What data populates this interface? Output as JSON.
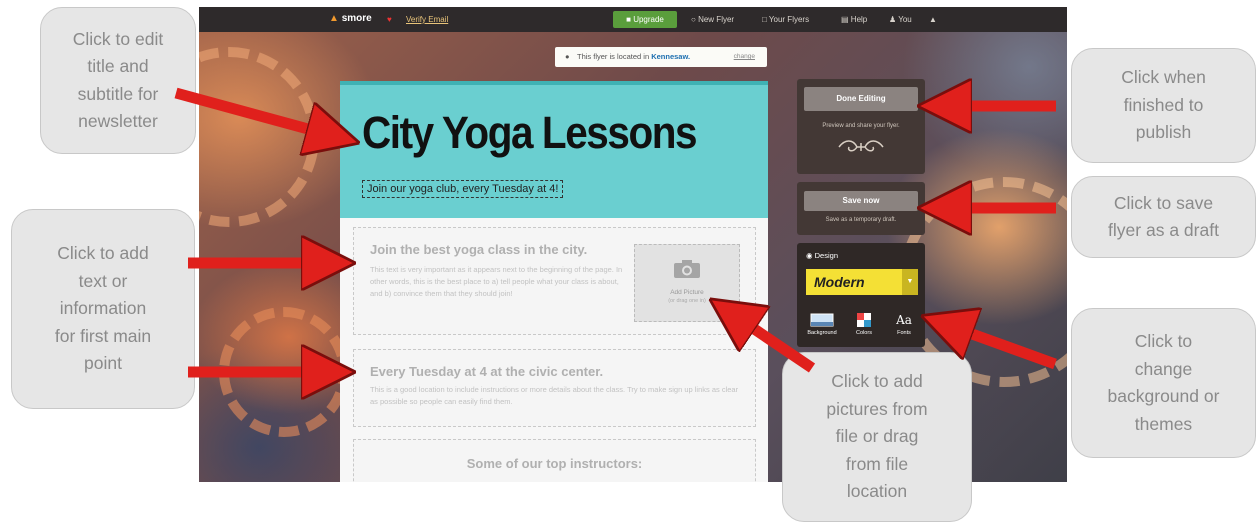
{
  "topbar": {
    "brand": "smore",
    "verify": "Verify Email",
    "upgrade": "Upgrade",
    "new_flyer": "New Flyer",
    "your_flyers": "Your Flyers",
    "help": "Help",
    "you": "You"
  },
  "location": {
    "prefix": "This flyer is located in ",
    "city": "Kennesaw.",
    "change": "change"
  },
  "flyer": {
    "title": "City Yoga Lessons",
    "subtitle": "Join our yoga club, every Tuesday at 4!",
    "block1": {
      "heading": "Join the best yoga class in the city.",
      "body": "This text is very important as it appears next to the beginning of the page. In other words, this is the best place to a) tell people what your class is about, and b) convince them that they should join!"
    },
    "picture": {
      "label": "Add Picture",
      "sub": "(or drag one in)"
    },
    "block2": {
      "heading": "Every Tuesday at 4 at the civic center.",
      "body": "This is a good location to include instructions or more details about the class. Try to make sign up links as clear as possible so people can easily find them."
    },
    "block3": {
      "heading": "Some of our top instructors:"
    }
  },
  "sidebar": {
    "done_editing": "Done Editing",
    "done_sub": "Preview and share your flyer.",
    "save_now": "Save now",
    "save_sub": "Save as a temporary draft.",
    "design": "Design",
    "theme": "Modern",
    "options": [
      "Background",
      "Colors",
      "Fonts"
    ]
  },
  "callouts": {
    "title": [
      "Click to edit",
      "title and",
      "subtitle for",
      "newsletter"
    ],
    "text": [
      "Click to add",
      "text or",
      "information",
      "for first main",
      "point"
    ],
    "pictures": [
      "Click to add",
      "pictures from",
      "file or drag",
      "from file",
      "location"
    ],
    "publish": [
      "Click when",
      "finished to",
      "publish"
    ],
    "draft": [
      "Click to save",
      "flyer as a draft"
    ],
    "background": [
      "Click to",
      "change",
      "background or",
      "themes"
    ]
  },
  "colors": {
    "arrow": "#e0201c",
    "header": "#6acfd0",
    "theme": "#f4e035",
    "upgrade": "#5a9e3c"
  }
}
